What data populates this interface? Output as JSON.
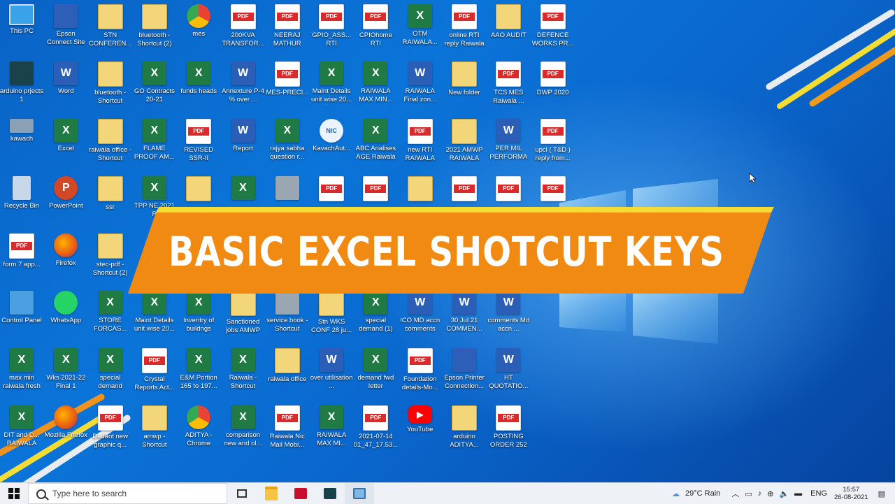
{
  "banner": {
    "title": "BASIC EXCEL SHOTCUT KEYS"
  },
  "icons": [
    {
      "label": "This PC",
      "kind": "pc",
      "col": 0,
      "row": 0
    },
    {
      "label": "Epson Connect Site",
      "kind": "eps",
      "col": 1,
      "row": 0
    },
    {
      "label": "STN CONFEREN...",
      "kind": "fold",
      "col": 2,
      "row": 0
    },
    {
      "label": "bluetooth - Shortcut (2)",
      "kind": "fold",
      "col": 3,
      "row": 0
    },
    {
      "label": "mes",
      "kind": "chrome",
      "col": 4,
      "row": 0
    },
    {
      "label": "200KVA TRANSFOR...",
      "kind": "pdf",
      "col": 5,
      "row": 0
    },
    {
      "label": "NEERAJ MATHUR",
      "kind": "pdf",
      "col": 6,
      "row": 0
    },
    {
      "label": "GPIO_ASS... RTI",
      "kind": "pdf",
      "col": 7,
      "row": 0
    },
    {
      "label": "CPIOhome RTI",
      "kind": "pdf",
      "col": 8,
      "row": 0
    },
    {
      "label": "OTM RAIWALA...",
      "kind": "xls",
      "col": 9,
      "row": 0
    },
    {
      "label": "online RTI reply Raiwala",
      "kind": "pdf",
      "col": 10,
      "row": 0
    },
    {
      "label": "AAO AUDIT",
      "kind": "fold",
      "col": 11,
      "row": 0
    },
    {
      "label": "DEFENCE WORKS PR...",
      "kind": "pdf",
      "col": 12,
      "row": 0
    },
    {
      "label": "arduino prjects 1",
      "kind": "dev",
      "col": 0,
      "row": 1
    },
    {
      "label": "Word",
      "kind": "doc",
      "col": 1,
      "row": 1
    },
    {
      "label": "bluetooth - Shortcut",
      "kind": "fold",
      "col": 2,
      "row": 1
    },
    {
      "label": "GO Contracts 20-21",
      "kind": "xls",
      "col": 3,
      "row": 1
    },
    {
      "label": "funds heads",
      "kind": "xls",
      "col": 4,
      "row": 1
    },
    {
      "label": "Annexture P-4 % over ...",
      "kind": "doc",
      "col": 5,
      "row": 1
    },
    {
      "label": "MES-PRECI...",
      "kind": "pdf",
      "col": 6,
      "row": 1
    },
    {
      "label": "Maint Details unit wise 20...",
      "kind": "xls",
      "col": 7,
      "row": 1
    },
    {
      "label": "RAIWALA MAX MIN...",
      "kind": "xls",
      "col": 8,
      "row": 1
    },
    {
      "label": "RAIWALA Final zon...",
      "kind": "doc",
      "col": 9,
      "row": 1
    },
    {
      "label": "New folder",
      "kind": "fold",
      "col": 10,
      "row": 1
    },
    {
      "label": "TCS MES Raiwala ...",
      "kind": "pdf",
      "col": 11,
      "row": 1
    },
    {
      "label": "DWP 2020",
      "kind": "pdf",
      "col": 12,
      "row": 1
    },
    {
      "label": "kawach",
      "kind": "kaw",
      "col": 0,
      "row": 2
    },
    {
      "label": "Excel",
      "kind": "xls",
      "col": 1,
      "row": 2
    },
    {
      "label": "raiwala office - Shortcut",
      "kind": "fold",
      "col": 2,
      "row": 2
    },
    {
      "label": "FLAME PROOF AM...",
      "kind": "xls",
      "col": 3,
      "row": 2
    },
    {
      "label": "REVISED SSR-II",
      "kind": "pdf",
      "col": 4,
      "row": 2
    },
    {
      "label": "Report",
      "kind": "doc",
      "col": 5,
      "row": 2
    },
    {
      "label": "rajya sabha question r...",
      "kind": "xls",
      "col": 6,
      "row": 2
    },
    {
      "label": "KavachAut...",
      "kind": "nic",
      "col": 7,
      "row": 2
    },
    {
      "label": "ABC Analises AGE Raiwala",
      "kind": "xls",
      "col": 8,
      "row": 2
    },
    {
      "label": "new RTI RAIWALA",
      "kind": "pdf",
      "col": 9,
      "row": 2
    },
    {
      "label": "2021 AMWP RAIWALA",
      "kind": "fold",
      "col": 10,
      "row": 2
    },
    {
      "label": "PER MIL PERFORMA",
      "kind": "doc",
      "col": 11,
      "row": 2
    },
    {
      "label": "upcl ( T&D ) reply from...",
      "kind": "pdf",
      "col": 12,
      "row": 2
    },
    {
      "label": "Recycle Bin",
      "kind": "bin",
      "col": 0,
      "row": 3
    },
    {
      "label": "PowerPoint",
      "kind": "ppt",
      "col": 1,
      "row": 3
    },
    {
      "label": "ssr",
      "kind": "fold",
      "col": 2,
      "row": 3
    },
    {
      "label": "TPP NE 2021 R",
      "kind": "xls",
      "col": 3,
      "row": 3
    },
    {
      "label": "",
      "kind": "fold",
      "col": 4,
      "row": 3
    },
    {
      "label": "",
      "kind": "xls",
      "col": 5,
      "row": 3
    },
    {
      "label": "",
      "kind": "gray",
      "col": 6,
      "row": 3
    },
    {
      "label": "",
      "kind": "pdf",
      "col": 7,
      "row": 3
    },
    {
      "label": "",
      "kind": "pdf",
      "col": 8,
      "row": 3
    },
    {
      "label": "",
      "kind": "fold",
      "col": 9,
      "row": 3
    },
    {
      "label": "",
      "kind": "pdf",
      "col": 10,
      "row": 3
    },
    {
      "label": "",
      "kind": "pdf",
      "col": 11,
      "row": 3
    },
    {
      "label": "",
      "kind": "pdf",
      "col": 12,
      "row": 3
    },
    {
      "label": "form 7 app...",
      "kind": "pdf",
      "col": 0,
      "row": 4
    },
    {
      "label": "Firefox",
      "kind": "fox",
      "col": 1,
      "row": 4
    },
    {
      "label": "stec-pdf - Shortcut (2)",
      "kind": "fold",
      "col": 2,
      "row": 4
    },
    {
      "label": "Control Panel",
      "kind": "cp",
      "col": 0,
      "row": 5
    },
    {
      "label": "WhatsApp",
      "kind": "wa",
      "col": 1,
      "row": 5
    },
    {
      "label": "STORE FORCAS...",
      "kind": "xls",
      "col": 2,
      "row": 5
    },
    {
      "label": "Maint Details unit wise 20...",
      "kind": "xls",
      "col": 3,
      "row": 5
    },
    {
      "label": "Inventry of buildngs",
      "kind": "xls",
      "col": 4,
      "row": 5
    },
    {
      "label": "Sanctioned jobs AMWP",
      "kind": "fold",
      "col": 5,
      "row": 5
    },
    {
      "label": "service book - Shortcut",
      "kind": "gray",
      "col": 6,
      "row": 5
    },
    {
      "label": "Stn WKS CONF 28 ju...",
      "kind": "fold",
      "col": 7,
      "row": 5
    },
    {
      "label": "special demand (1)",
      "kind": "xls",
      "col": 8,
      "row": 5
    },
    {
      "label": "ICO MD accn comments",
      "kind": "doc",
      "col": 9,
      "row": 5
    },
    {
      "label": "30 Jul 21 COMMEN...",
      "kind": "doc",
      "col": 10,
      "row": 5
    },
    {
      "label": "comments Md accn ...",
      "kind": "doc",
      "col": 11,
      "row": 5
    },
    {
      "label": "max min raiwala fresh",
      "kind": "xls",
      "col": 0,
      "row": 6
    },
    {
      "label": "Wks 2021-22 Final 1",
      "kind": "xls",
      "col": 1,
      "row": 6
    },
    {
      "label": "special demand",
      "kind": "xls",
      "col": 2,
      "row": 6
    },
    {
      "label": "Crystal Reports Act...",
      "kind": "pdf",
      "col": 3,
      "row": 6
    },
    {
      "label": "E&M Portion 165 to 197...",
      "kind": "xls",
      "col": 4,
      "row": 6
    },
    {
      "label": "Raiwala - Shortcut",
      "kind": "xls",
      "col": 5,
      "row": 6
    },
    {
      "label": "raiwala office",
      "kind": "fold",
      "col": 6,
      "row": 6
    },
    {
      "label": "over utilisation ...",
      "kind": "doc",
      "col": 7,
      "row": 6
    },
    {
      "label": "demand fwd letter",
      "kind": "xls",
      "col": 8,
      "row": 6
    },
    {
      "label": "Foundation details-Mo...",
      "kind": "pdf",
      "col": 9,
      "row": 6
    },
    {
      "label": "Epson Printer Connection...",
      "kind": "eps",
      "col": 10,
      "row": 6
    },
    {
      "label": "HT QUOTATIO...",
      "kind": "doc",
      "col": 11,
      "row": 6
    },
    {
      "label": "DIT and D... RAIWALA",
      "kind": "xls",
      "col": 0,
      "row": 7
    },
    {
      "label": "Mozilla Firefox",
      "kind": "fox",
      "col": 1,
      "row": 7
    },
    {
      "label": "Dadant new graphic q...",
      "kind": "pdf",
      "col": 2,
      "row": 7
    },
    {
      "label": "amwp - Shortcut",
      "kind": "fold",
      "col": 3,
      "row": 7
    },
    {
      "label": "ADITYA - Chrome",
      "kind": "chrome",
      "col": 4,
      "row": 7
    },
    {
      "label": "comparison new and ol...",
      "kind": "xls",
      "col": 5,
      "row": 7
    },
    {
      "label": "Raiwala Nic Mail Mobi...",
      "kind": "pdf",
      "col": 6,
      "row": 7
    },
    {
      "label": "RAIWALA MAX MI...",
      "kind": "xls",
      "col": 7,
      "row": 7
    },
    {
      "label": "2021-07-14 01_47_17.53...",
      "kind": "pdf",
      "col": 8,
      "row": 7
    },
    {
      "label": "YouTube",
      "kind": "yt",
      "col": 9,
      "row": 7
    },
    {
      "label": "arduino ADITYA...",
      "kind": "fold",
      "col": 10,
      "row": 7
    },
    {
      "label": "POSTING ORDER 252",
      "kind": "pdf",
      "col": 11,
      "row": 7
    }
  ],
  "taskbar": {
    "search_placeholder": "Type here to search",
    "weather": "29°C  Rain",
    "lang": "ENG",
    "time": "15:57",
    "date": "26-08-2021"
  }
}
